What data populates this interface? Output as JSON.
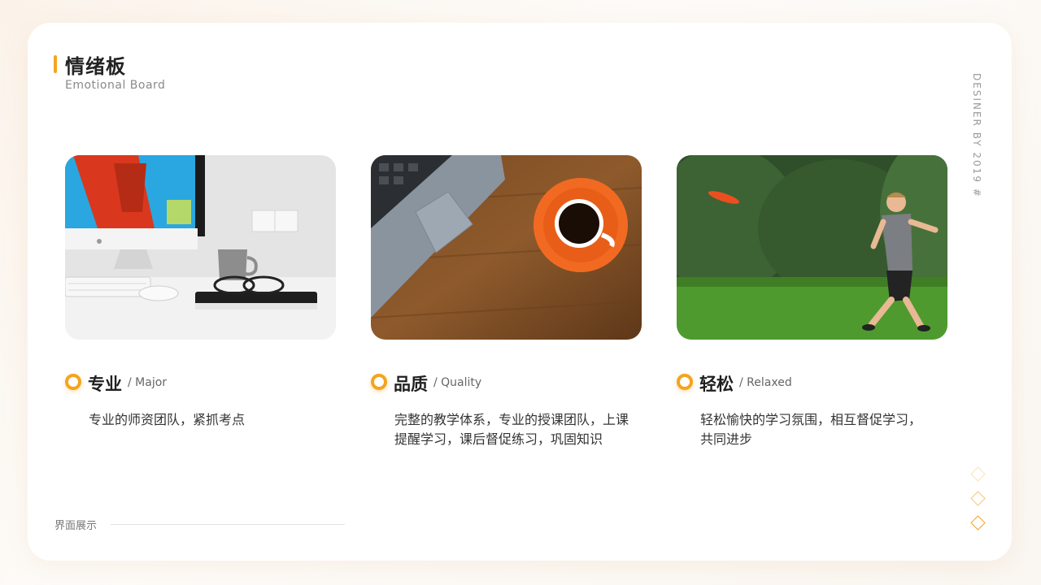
{
  "header": {
    "title": "情绪板",
    "subtitle": "Emotional Board"
  },
  "credit": "DESINER BY 2019 #",
  "features": [
    {
      "title": "专业",
      "english": "/ Major",
      "description": "专业的师资团队，紧抓考点",
      "image": "desk-with-monitor-photo"
    },
    {
      "title": "品质",
      "english": "/ Quality",
      "description": "完整的教学体系，专业的授课团队，上课提醒学习，课后督促练习，巩固知识",
      "image": "laptop-and-coffee-photo"
    },
    {
      "title": "轻松",
      "english": "/ Relaxed",
      "description": "轻松愉快的学习氛围，相互督促学习，共同进步",
      "image": "boy-throwing-frisbee-photo"
    }
  ],
  "footer": {
    "label": "界面展示"
  },
  "colors": {
    "accent": "#f4a41e",
    "text": "#222222",
    "muted": "#8a8a8a"
  }
}
